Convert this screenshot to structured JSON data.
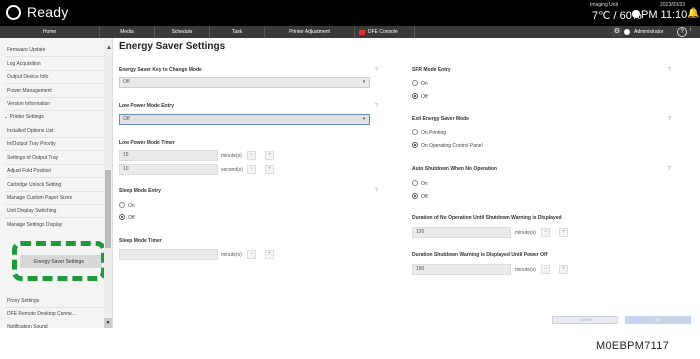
{
  "app": {
    "title": "Ready"
  },
  "status": {
    "imaging_unit_label": "Imaging Unit",
    "temp_humidity": "7℃ / 60%",
    "date": "2023/03/23",
    "time": "PM 11:10"
  },
  "nav": {
    "tabs": [
      "Home",
      "Media",
      "Schedule",
      "Task",
      "Printer Adjustment",
      "DFE Console"
    ]
  },
  "toolbar": {
    "user": "Administrator",
    "help": "?",
    "info": "i"
  },
  "sidebar": {
    "items": [
      "Firmware Update",
      "Log Acquisition",
      "Output Device Info",
      "Power Management",
      "Version Information"
    ],
    "section": "Printer Settings",
    "sub_items": [
      "Installed Options List",
      "In/Output Tray Priority",
      "Settings of Output Tray",
      "Adjust Fold Position",
      "Cartridge Unlock Setting",
      "Manage Custom Paper Sizes",
      "Unit Display Switching",
      "Manage Settings Display"
    ],
    "selected": "Energy Saver Settings",
    "lower_items": [
      "Proxy Settings",
      "DFE Remote Desktop Conne…",
      "Notification Sound"
    ]
  },
  "main": {
    "title": "Energy Saver Settings",
    "energy_key": {
      "label": "Energy Saver Key to Change Mode",
      "value": "Off"
    },
    "low_power_entry": {
      "label": "Low Power Mode Entry",
      "value": "Off"
    },
    "low_power_timer": {
      "label": "Low Power Mode Timer",
      "minutes": "15",
      "minutes_unit": "minute(s)",
      "seconds": "10",
      "seconds_unit": "second(s)"
    },
    "sleep_entry": {
      "label": "Sleep Mode Entry",
      "options": [
        "On",
        "Off"
      ],
      "selected": "Off"
    },
    "sleep_timer": {
      "label": "Sleep Mode Timer",
      "unit": "minute(s)"
    },
    "sfr_entry": {
      "label": "SFR Mode Entry",
      "options": [
        "On",
        "Off"
      ],
      "selected": "Off"
    },
    "exit_mode": {
      "label": "Exit Energy Saver Mode",
      "options": [
        "On Printing",
        "On Operating Control Panel"
      ],
      "selected": "On Operating Control Panel"
    },
    "auto_shutdown": {
      "label": "Auto Shutdown When No Operation",
      "options": [
        "On",
        "Off"
      ],
      "selected": "Off"
    },
    "no_op_duration": {
      "label": "Duration of No Operation Until Shutdown Warning is Displayed",
      "value": "120",
      "unit": "minute(s)"
    },
    "warning_duration": {
      "label": "Duration Shutdown Warning is Displayed Until Power Off",
      "value": "180",
      "unit": "minute(s)"
    },
    "cancel": "Cancel",
    "ok": "OK"
  },
  "footnote": "M0EBPM7117"
}
